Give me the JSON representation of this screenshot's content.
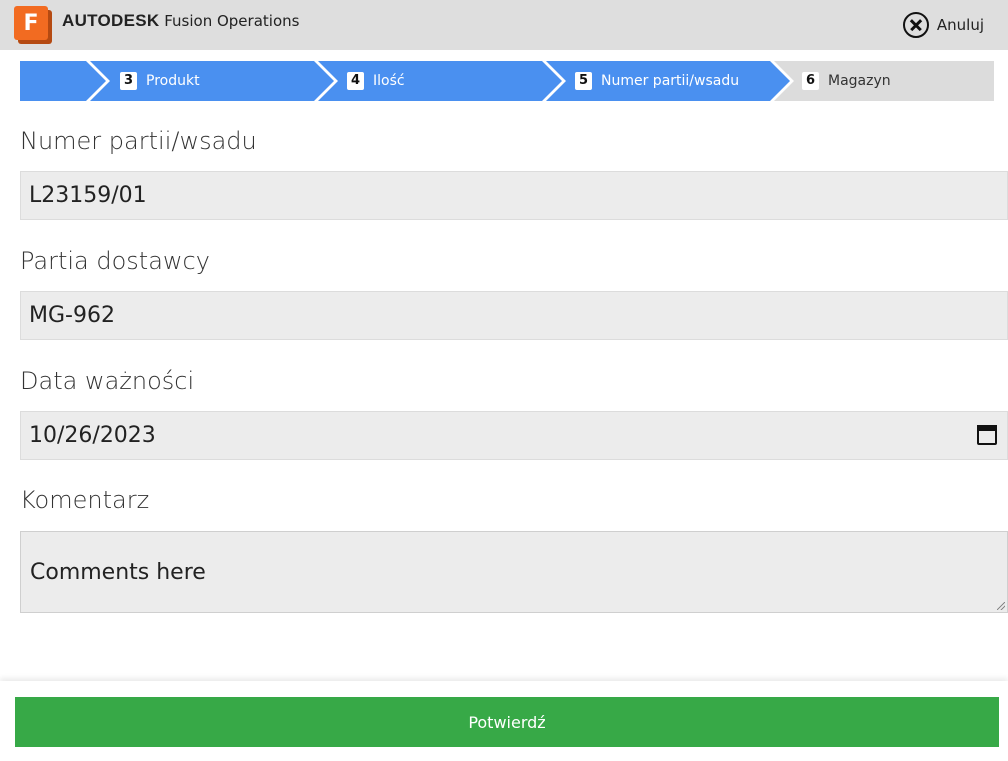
{
  "header": {
    "logo_letter": "F",
    "brand_bold": "AUTODESK",
    "brand_rest": "Fusion Operations",
    "cancel_label": "Anuluj",
    "cancel_icon": "close-circle-icon"
  },
  "steps": [
    {
      "number": "3",
      "label": "Produkt",
      "state": "completed"
    },
    {
      "number": "4",
      "label": "Ilość",
      "state": "completed"
    },
    {
      "number": "5",
      "label": "Numer partii/wsadu",
      "state": "current"
    },
    {
      "number": "6",
      "label": "Magazyn",
      "state": "upcoming"
    }
  ],
  "colors": {
    "step_active": "#4a90f0",
    "step_inactive": "#dcdcdc",
    "confirm": "#37a947",
    "logo": "#f26b21"
  },
  "form": {
    "batch_label": "Numer partii/wsadu",
    "batch_value": "L23159/01",
    "supplier_batch_label": "Partia dostawcy",
    "supplier_batch_value": "MG-962",
    "expiry_label": "Data ważności",
    "expiry_value": "10/26/2023",
    "comment_label": "Komentarz",
    "comment_placeholder": "Comments here"
  },
  "footer": {
    "confirm_label": "Potwierdź"
  }
}
